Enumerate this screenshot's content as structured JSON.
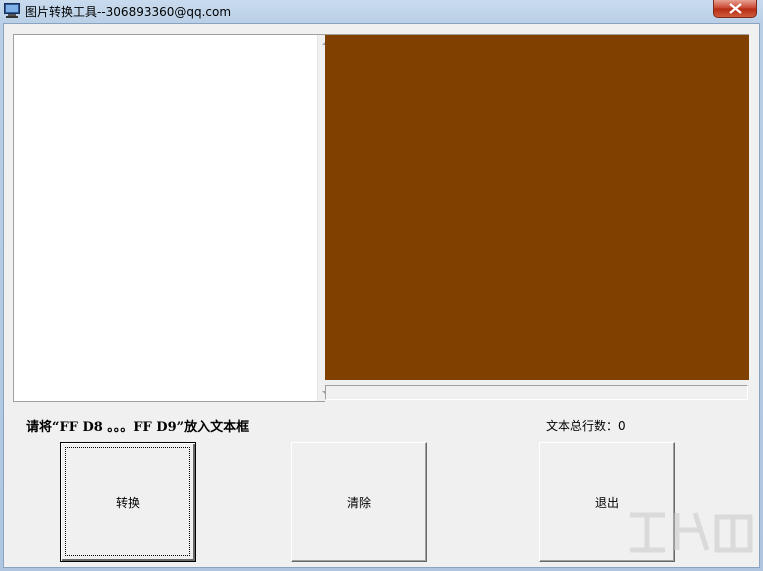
{
  "window": {
    "title": "图片转换工具--306893360@qq.com",
    "close_glyph": "✕"
  },
  "picture": {
    "background_color": "#804000"
  },
  "labels": {
    "instruction": "请将“FF D8 。。。FF D9”放入文本框",
    "line_count_label": "文本总行数：",
    "line_count_value": "0"
  },
  "buttons": {
    "convert": "转换",
    "clear": "清除",
    "exit": "退出"
  },
  "icons": {
    "app": "app-icon",
    "close": "close-icon",
    "scroll_up": "scroll-up-arrow-icon",
    "scroll_down": "scroll-down-arrow-icon"
  }
}
